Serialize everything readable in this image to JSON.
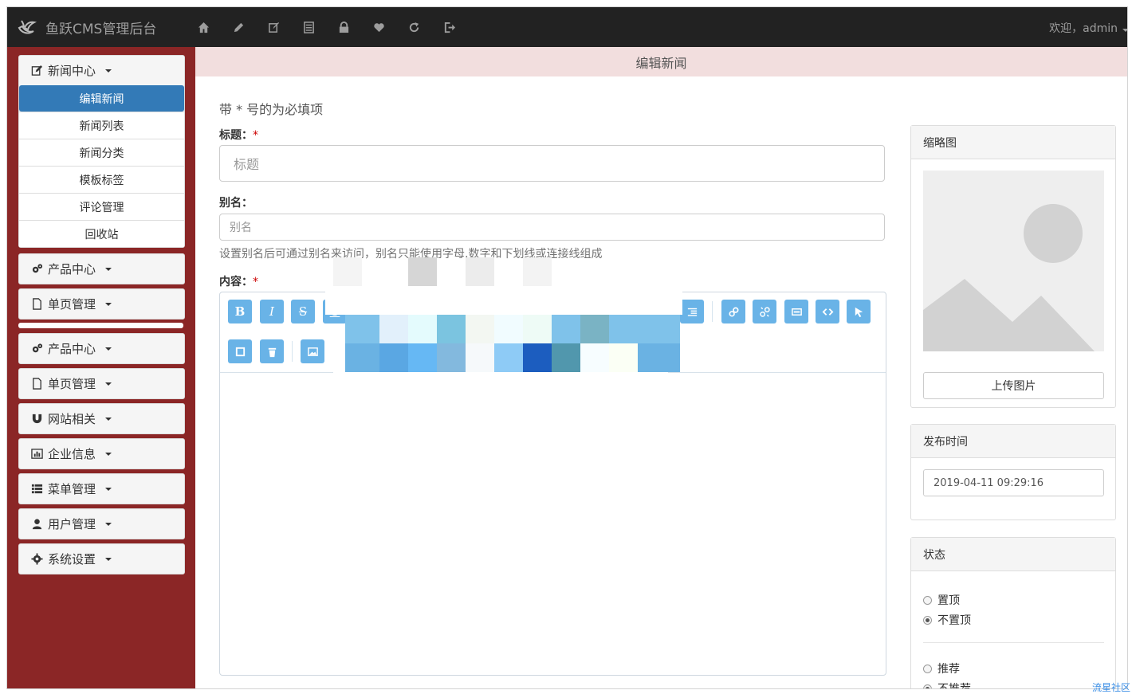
{
  "navbar": {
    "brand": "鱼跃CMS管理后台",
    "welcome": "欢迎，admin",
    "icons": [
      "home-icon",
      "pencil-icon",
      "edit-square-icon",
      "list-alt-icon",
      "lock-icon",
      "heart-icon",
      "refresh-icon",
      "logout-icon"
    ]
  },
  "sidebar": {
    "news_center": {
      "label": "新闻中心",
      "items": [
        "编辑新闻",
        "新闻列表",
        "新闻分类",
        "模板标签",
        "评论管理",
        "回收站"
      ]
    },
    "menus": [
      {
        "label": "产品中心",
        "icon": "cogs-icon"
      },
      {
        "label": "单页管理",
        "icon": "file-icon"
      },
      {
        "label": "产品中心",
        "icon": "cogs-icon"
      },
      {
        "label": "单页管理",
        "icon": "file-icon"
      },
      {
        "label": "网站相关",
        "icon": "magnet-icon"
      },
      {
        "label": "企业信息",
        "icon": "stats-icon"
      },
      {
        "label": "菜单管理",
        "icon": "th-list-icon"
      },
      {
        "label": "用户管理",
        "icon": "user-icon"
      },
      {
        "label": "系统设置",
        "icon": "cog-icon"
      }
    ]
  },
  "main": {
    "page_title": "编辑新闻",
    "required_note": "带 * 号的为必填项",
    "title_label": "标题：",
    "title_placeholder": "标题",
    "alias_label": "别名：",
    "alias_placeholder": "别名",
    "alias_help": "设置别名后可通过别名来访问，别名只能使用字母,数字和下划线或连接线组成",
    "content_label": "内容：",
    "required_mark": "*"
  },
  "right": {
    "thumbnail_title": "缩略图",
    "upload_label": "上传图片",
    "publish_time_title": "发布时间",
    "publish_time_value": "2019-04-11 09:29:16",
    "status_title": "状态",
    "top_options": [
      {
        "label": "置顶",
        "checked": false
      },
      {
        "label": "不置顶",
        "checked": true
      }
    ],
    "recommend_options": [
      {
        "label": "推荐",
        "checked": false
      },
      {
        "label": "不推荐",
        "checked": true
      }
    ]
  },
  "watermark": "流星社区",
  "colors": {
    "navbar": "#222222",
    "sidebar": "#8b2626",
    "active": "#337ab7",
    "title_bar": "#f2dede",
    "toolbar_btn": "#69b3e7"
  }
}
